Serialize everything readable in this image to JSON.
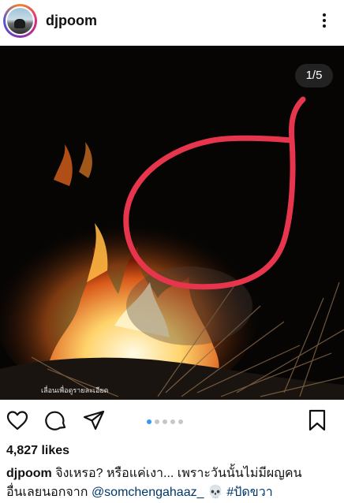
{
  "post": {
    "username": "djpoom",
    "media_counter": "1/5",
    "overlay_text": "เลื่อนเพื่อดูรายละเอียด",
    "likes": "4,827 likes",
    "caption": {
      "username": "djpoom",
      "text_line1": "จิงเหรอ? หรือแค่เงา... เพราะวันนั้นไม่มีผญคน",
      "text_line2": "อื่นเลยนอกจาก",
      "mention": "@somchengahaaz_",
      "emoji": "💀",
      "hashtag": "#ปัดขวา"
    }
  },
  "carousel": {
    "total": 5,
    "active_index": 0
  },
  "colors": {
    "accent_blue": "#3897f0",
    "annotation_red": "#e8354e"
  },
  "icons": [
    "heart-icon",
    "comment-icon",
    "share-icon",
    "bookmark-icon",
    "more-icon"
  ]
}
